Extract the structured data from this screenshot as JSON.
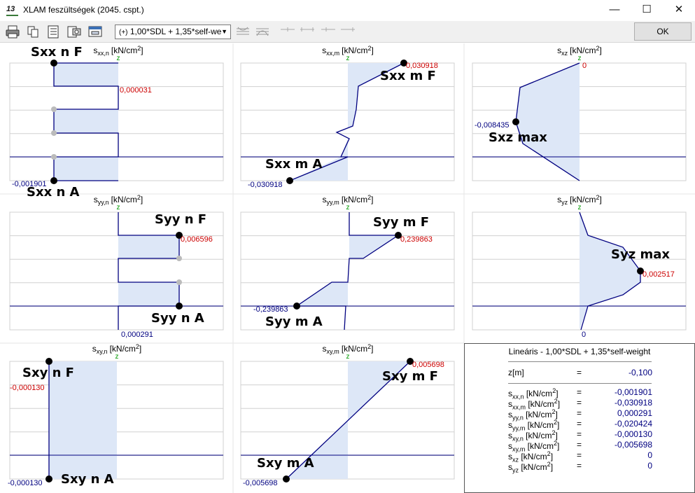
{
  "window": {
    "app_icon_text": "13",
    "title": "XLAM feszültségek (2045. cspt.)",
    "minimize": "—",
    "maximize": "☐",
    "close": "✕"
  },
  "toolbar": {
    "combo_icon": "(+)",
    "combo_value": "1,00*SDL + 1,35*self-we",
    "ok_label": "OK"
  },
  "panels": [
    {
      "id": "sxx_n",
      "header_sym": "s",
      "header_sub": "xx,n",
      "unit": "[kN/cm",
      "unit_exp": "2",
      "unit_end": "]",
      "z_label": "z",
      "labels": [
        "Sxx n F",
        "Sxx n A"
      ],
      "values": [
        "0,000031",
        "-0,001901"
      ]
    },
    {
      "id": "sxx_m",
      "header_sym": "s",
      "header_sub": "xx,m",
      "unit": "[kN/cm",
      "unit_exp": "2",
      "unit_end": "]",
      "z_label": "z",
      "labels": [
        "Sxx m F",
        "Sxx m A"
      ],
      "values": [
        "0,030918",
        "-0,030918"
      ]
    },
    {
      "id": "sxz",
      "header_sym": "s",
      "header_sub": "xz",
      "unit": "[kN/cm",
      "unit_exp": "2",
      "unit_end": "]",
      "z_label": "z",
      "labels": [
        "Sxz max"
      ],
      "values": [
        "0",
        "-0,008435"
      ]
    },
    {
      "id": "syy_n",
      "header_sym": "s",
      "header_sub": "yy,n",
      "unit": "[kN/cm",
      "unit_exp": "2",
      "unit_end": "]",
      "z_label": "z",
      "labels": [
        "Syy n F",
        "Syy n A"
      ],
      "values": [
        "0,006596",
        "0,000291"
      ]
    },
    {
      "id": "syy_m",
      "header_sym": "s",
      "header_sub": "yy,m",
      "unit": "[kN/cm",
      "unit_exp": "2",
      "unit_end": "]",
      "z_label": "z",
      "labels": [
        "Syy m F",
        "Syy m A"
      ],
      "values": [
        "0,239863",
        "-0,239863"
      ]
    },
    {
      "id": "syz",
      "header_sym": "s",
      "header_sub": "yz",
      "unit": "[kN/cm",
      "unit_exp": "2",
      "unit_end": "]",
      "z_label": "z",
      "labels": [
        "Syz max"
      ],
      "values": [
        "0,002517",
        "0"
      ]
    },
    {
      "id": "sxy_n",
      "header_sym": "s",
      "header_sub": "xy,n",
      "unit": "[kN/cm",
      "unit_exp": "2",
      "unit_end": "]",
      "z_label": "z",
      "labels": [
        "Sxy n F",
        "Sxy n A"
      ],
      "values": [
        "-0,000130",
        "-0,000130"
      ]
    },
    {
      "id": "sxy_m",
      "header_sym": "s",
      "header_sub": "xy,m",
      "unit": "[kN/cm",
      "unit_exp": "2",
      "unit_end": "]",
      "z_label": "z",
      "labels": [
        "Sxy m F",
        "Sxy m A"
      ],
      "values": [
        "0,005698",
        "-0,005698"
      ]
    }
  ],
  "summary": {
    "title": "Lineáris - 1,00*SDL + 1,35*self-weight",
    "z_row": {
      "key": "z[m]",
      "eq": "=",
      "value": "-0,100"
    },
    "rows": [
      {
        "sym": "s",
        "sub": "xx,n",
        "unit": " [kN/cm",
        "exp": "2",
        "end": "]",
        "eq": "=",
        "value": "-0,001901"
      },
      {
        "sym": "s",
        "sub": "xx,m",
        "unit": " [kN/cm",
        "exp": "2",
        "end": "]",
        "eq": "=",
        "value": "-0,030918"
      },
      {
        "sym": "s",
        "sub": "yy,n",
        "unit": " [kN/cm",
        "exp": "2",
        "end": "]",
        "eq": "=",
        "value": "0,000291"
      },
      {
        "sym": "s",
        "sub": "yy,m",
        "unit": " [kN/cm",
        "exp": "2",
        "end": "]",
        "eq": "=",
        "value": "-0,020424"
      },
      {
        "sym": "s",
        "sub": "xy,n",
        "unit": " [kN/cm",
        "exp": "2",
        "end": "]",
        "eq": "=",
        "value": "-0,000130"
      },
      {
        "sym": "s",
        "sub": "xy,m",
        "unit": " [kN/cm",
        "exp": "2",
        "end": "]",
        "eq": "=",
        "value": "-0,005698"
      },
      {
        "sym": "s",
        "sub": "xz",
        "unit": " [kN/cm",
        "exp": "2",
        "end": "]",
        "eq": "=",
        "value": "0"
      },
      {
        "sym": "s",
        "sub": "yz",
        "unit": " [kN/cm",
        "exp": "2",
        "end": "]",
        "eq": "=",
        "value": "0"
      }
    ]
  },
  "colors": {
    "fill": "#dde7f7",
    "line": "#000080",
    "value_red": "#cc0000",
    "value_blue": "#000080",
    "z_green": "#009900",
    "grid": "#d0d0d0"
  }
}
